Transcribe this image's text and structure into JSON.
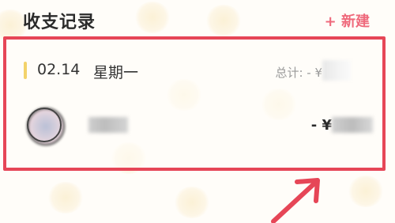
{
  "header": {
    "title": "收支记录",
    "new_button": "+ 新建"
  },
  "record_group": {
    "date": "02.14",
    "weekday": "星期一",
    "total_label": "总计: - ¥",
    "items": [
      {
        "amount_prefix": "- ¥"
      }
    ]
  },
  "colors": {
    "accent_red": "#e64657",
    "new_button_pink": "#ef6a7c",
    "date_accent_yellow": "#f3d36b"
  },
  "icons": {
    "avatar": "avatar",
    "annotation_arrow": "arrow-up-right-icon"
  }
}
